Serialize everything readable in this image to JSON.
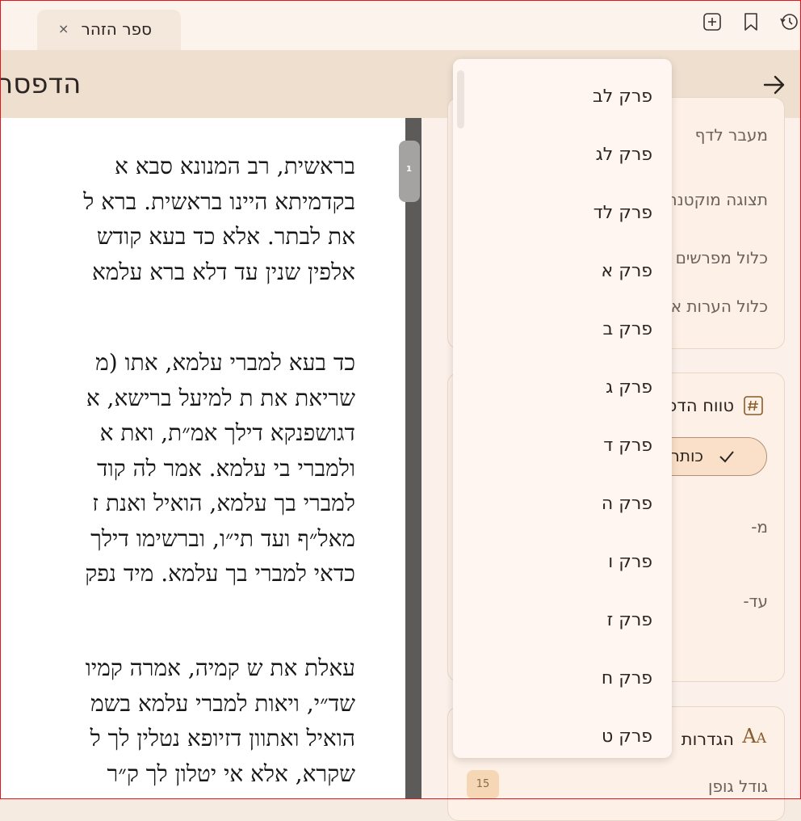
{
  "tab": {
    "title": "ספר הזהר",
    "close": "×"
  },
  "header": {
    "title": "הדפסה"
  },
  "reader": {
    "paragraphs": [
      [
        "בראשית, רב המנונא סבא א",
        "בקדמיתא היינו בראשית. ברא ל",
        "את לבתר. אלא כד בעא קודש",
        "אלפין שנין עד דלא ברא עלמא"
      ],
      [
        "כד בעא למברי עלמא, אתו (מ",
        "שריאת את ת למיעל ברישא, א",
        "דגושפנקא דילך אמ״ת, ואת א",
        "ולמברי בי עלמא. אמר לה קוד",
        "למברי בך עלמא, הואיל ואנת ז",
        "מאל״ף ועד תי״ו, וברשימו דילך",
        "כדאי למברי בך עלמא. מיד נפק"
      ],
      [
        "עאלת את ש קמיה, אמרה קמיו",
        "שד״י, ויאות למברי עלמא בשמ",
        "הואיל ואתוון דזיופא נטלין לך ל",
        "שקרא, אלא אי יטלון לך ק״ר"
      ]
    ],
    "scroll_page": "1"
  },
  "panel": {
    "rows": [
      "מעבר לדף",
      "תצוגה מוקטנת",
      "כלול מפרשים",
      "כלול הערות א"
    ],
    "range_title": "טווח הדפסה",
    "range_chip": "כותרות",
    "from_label": "מ-",
    "to_label": "עד-",
    "settings_title": "הגדרות",
    "font_size_label": "גודל גופן",
    "font_size_value": "15"
  },
  "dropdown": {
    "items": [
      "פרק לב",
      "פרק לג",
      "פרק לד",
      "פרק א",
      "פרק ב",
      "פרק ג",
      "פרק ד",
      "פרק ה",
      "פרק ו",
      "פרק ז",
      "פרק ח",
      "פרק ט"
    ]
  },
  "colors": {
    "accent": "#f5d7b5",
    "header_bg": "#efdfcf",
    "border": "#e8141c"
  }
}
